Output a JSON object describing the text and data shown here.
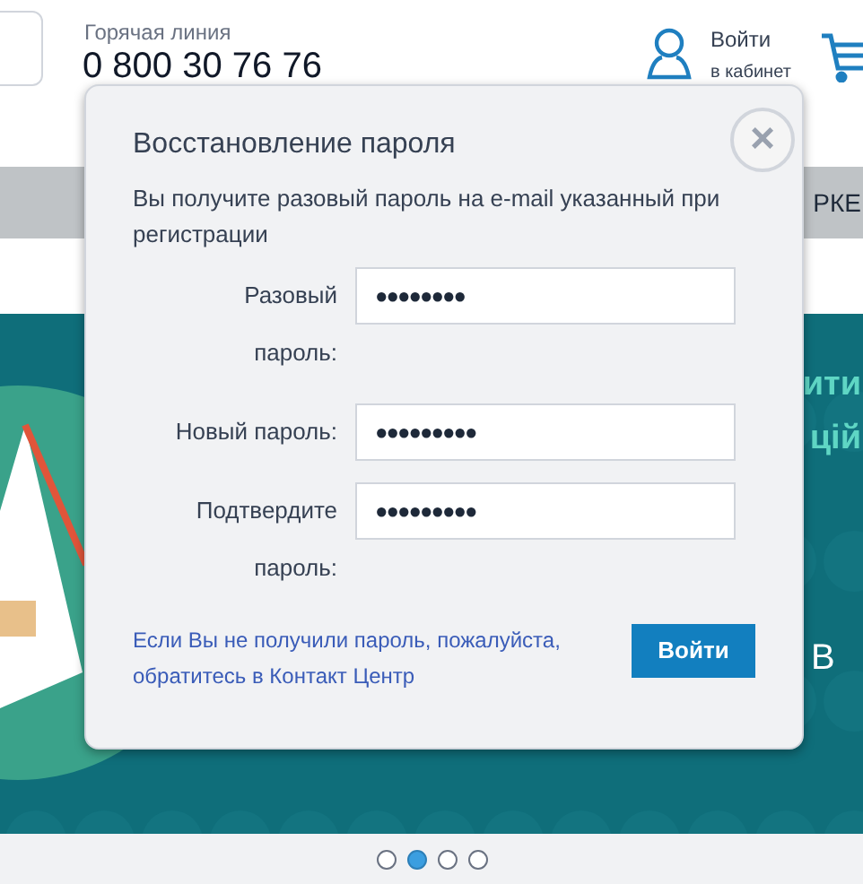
{
  "header": {
    "hotline_label": "Горячая линия",
    "hotline_number": "0 800 30 76 76",
    "login": {
      "line1": "Войти",
      "line2": "в кабинет"
    }
  },
  "nav": {
    "item_cut": "РКЕ"
  },
  "banner": {
    "text_lines": [
      "ити",
      "цій",
      "В"
    ]
  },
  "slider_dots": [
    {
      "selected": false
    },
    {
      "selected": true
    },
    {
      "selected": false
    },
    {
      "selected": false
    }
  ],
  "modal": {
    "title": "Восстановление пароля",
    "close": "×",
    "description": "Вы получите разовый пароль на e-mail указанный при регистрации",
    "fields": [
      {
        "label": "Разовый пароль:",
        "value": "●●●●●●●●"
      },
      {
        "label": "Новый пароль:",
        "value": "●●●●●●●●●"
      },
      {
        "label": "Подтвердите пароль:",
        "value": "●●●●●●●●●"
      }
    ],
    "help_link": "Если Вы не получили пароль, пожалуйста, обратитесь в Контакт Центр",
    "submit": "Войти"
  }
}
